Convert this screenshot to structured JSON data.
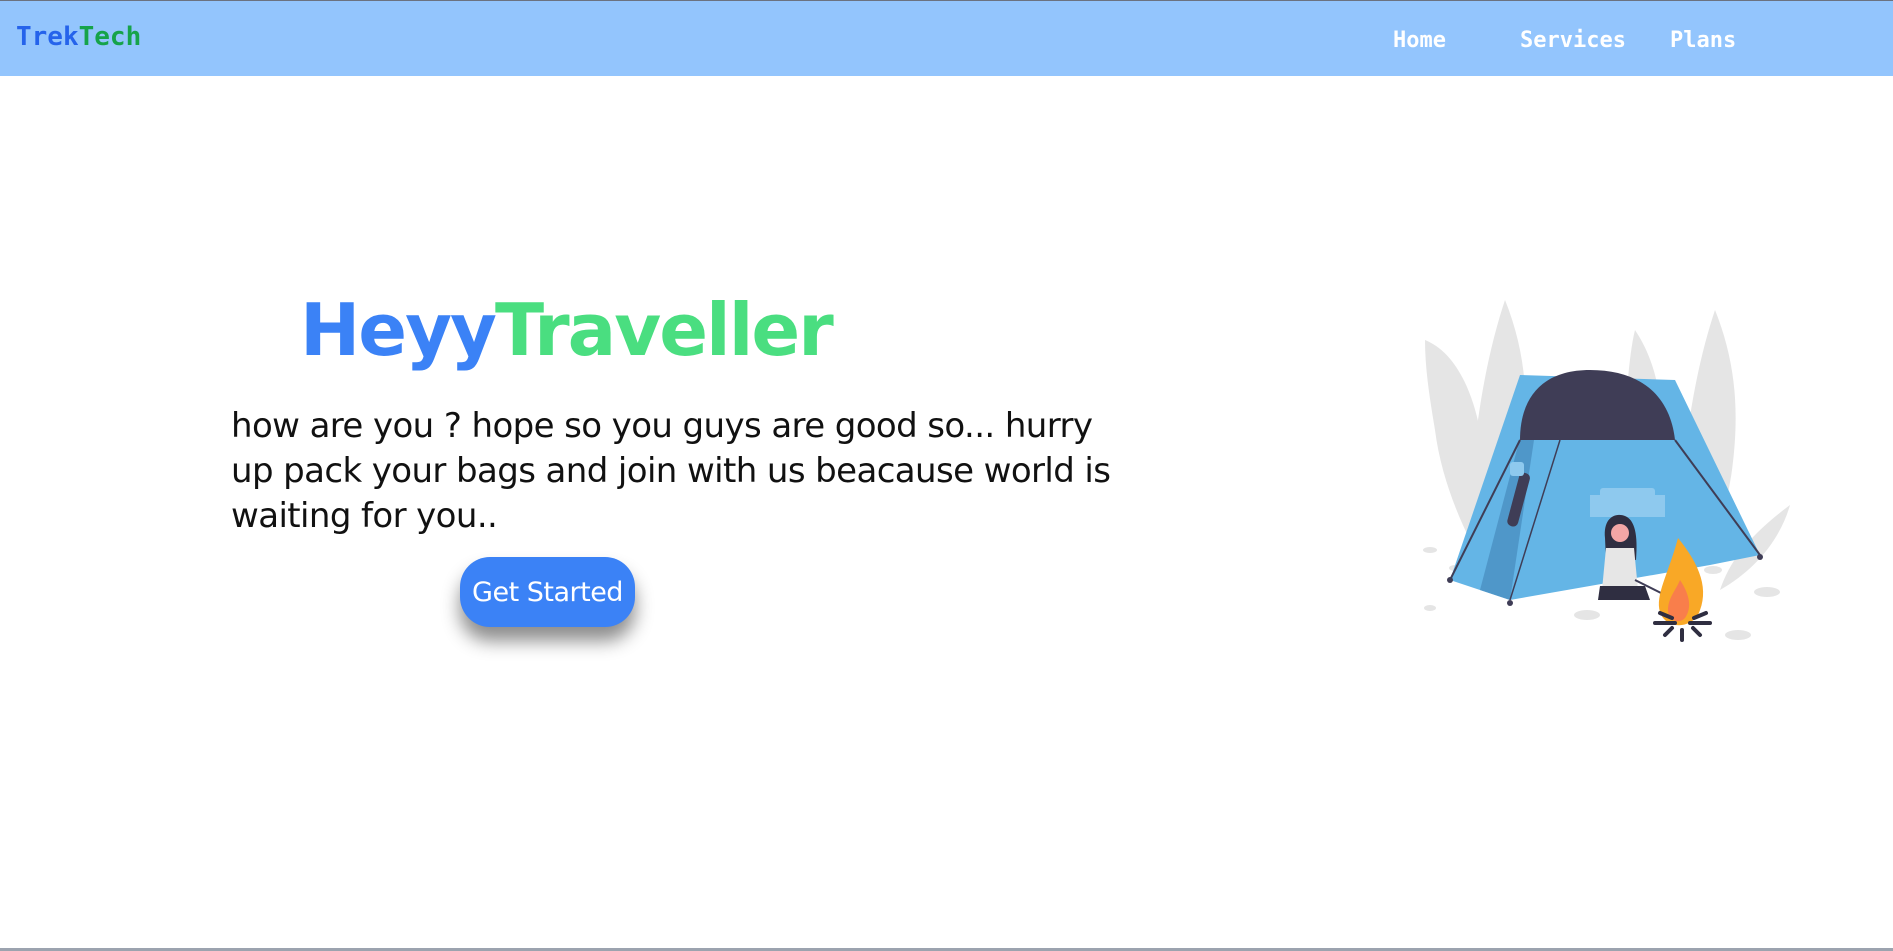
{
  "navbar": {
    "brand_part1": "Trek",
    "brand_part2": "Tech",
    "links": [
      {
        "label": "Home"
      },
      {
        "label": "Services"
      },
      {
        "label": "Plans"
      }
    ]
  },
  "hero": {
    "title_part1": "Heyy",
    "title_part2": "Traveller",
    "paragraph": "how are you ? hope so you guys are good so... hurry up pack your bags and join with us beacause world is waiting for you..",
    "cta_label": "Get Started"
  },
  "illustration": {
    "icon": "camping-tent-illustration"
  },
  "colors": {
    "navbar_bg": "#93c5fd",
    "brand_blue": "#2563eb",
    "brand_green": "#16a34a",
    "title_blue": "#3b82f6",
    "title_green": "#4ade80",
    "button_bg": "#3b82f6"
  }
}
